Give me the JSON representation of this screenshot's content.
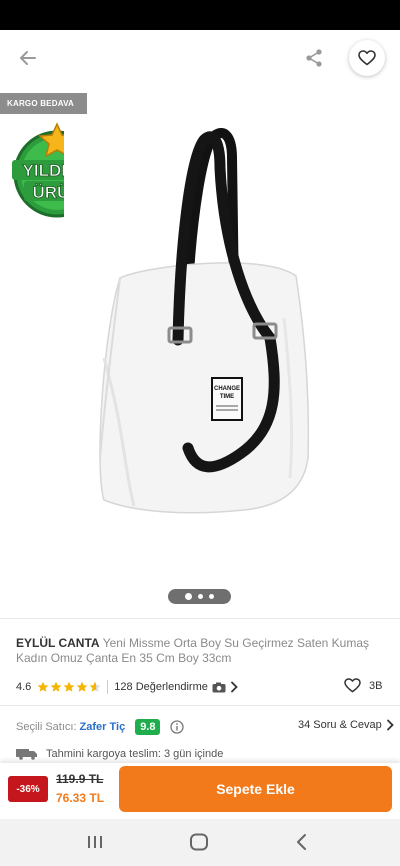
{
  "badges": {
    "kargo": "KARGO BEDAVA",
    "yildizli_line1": "YILDIZLI",
    "yildizli_line2": "ÜRÜN"
  },
  "product": {
    "brand": "EYLÜL CANTA",
    "name": "Yeni Missme Orta Boy Su Geçirmez Saten Kumaş Kadın Omuz Çanta En 35 Cm Boy 33cm",
    "tag_line1": "CHANGE",
    "tag_line2": "TIME",
    "image_count": 3,
    "image_index": 1
  },
  "rating": {
    "value": "4.6",
    "stars": 4.6,
    "reviews": "128 Değerlendirme",
    "favorites": "3B"
  },
  "seller": {
    "label": "Seçili Satıcı:",
    "name": "Zafer Tiç",
    "score": "9.8",
    "qa": "34 Soru & Cevap"
  },
  "cargo": {
    "text": "Tahmini kargoya teslim: 3 gün içinde"
  },
  "pricing": {
    "discount": "-36%",
    "old_price": "119.9 TL",
    "new_price": "76.33 TL",
    "cta": "Sepete Ekle"
  },
  "colors": {
    "accent": "#f27a1a",
    "discount_red": "#c4161c",
    "seller_blue": "#2a6fc9",
    "score_green": "#1fae4b"
  },
  "icons": [
    "back-arrow-icon",
    "share-icon",
    "heart-icon",
    "camera-icon",
    "chevron-right-icon",
    "info-icon",
    "truck-icon",
    "nav-recents-icon",
    "nav-home-icon",
    "nav-back-icon"
  ]
}
